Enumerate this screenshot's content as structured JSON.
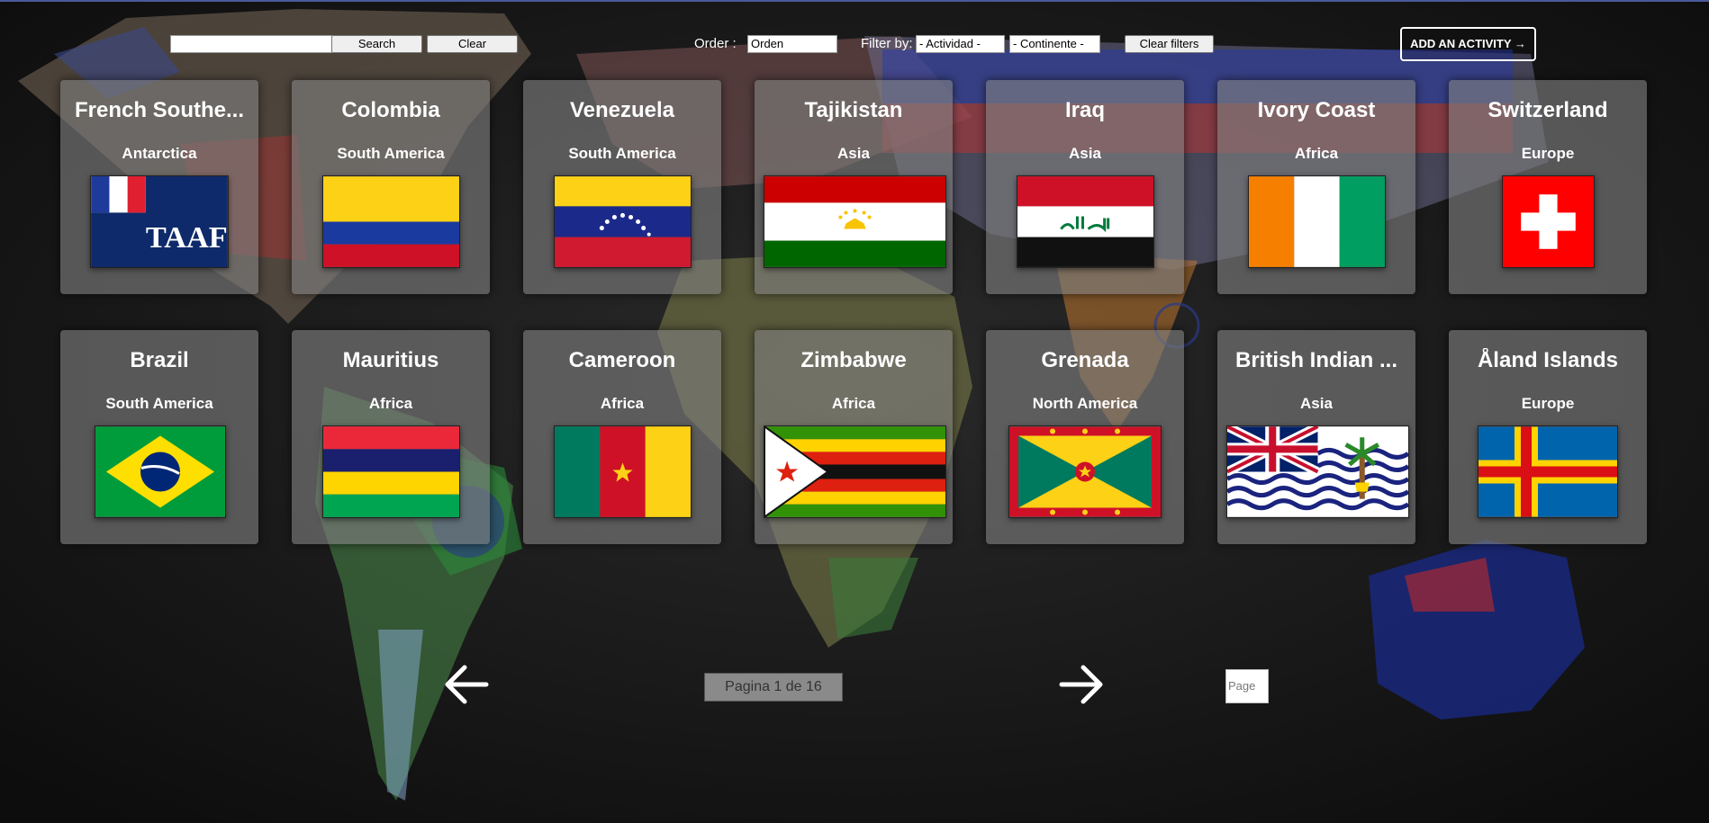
{
  "toolbar": {
    "search_placeholder": "",
    "search_label": "Search",
    "clear_label": "Clear",
    "order_label": "Order :",
    "order_value": "Orden",
    "filter_label": "Filter by:",
    "activity_value": "- Actividad -",
    "continent_value": "- Continente -",
    "clear_filters_label": "Clear filters",
    "add_activity_label": "ADD AN ACTIVITY →"
  },
  "countries": [
    {
      "name": "French Southe...",
      "continent": "Antarctica",
      "flag": "french-southern-territories"
    },
    {
      "name": "Colombia",
      "continent": "South America",
      "flag": "colombia"
    },
    {
      "name": "Venezuela",
      "continent": "South America",
      "flag": "venezuela"
    },
    {
      "name": "Tajikistan",
      "continent": "Asia",
      "flag": "tajikistan"
    },
    {
      "name": "Iraq",
      "continent": "Asia",
      "flag": "iraq"
    },
    {
      "name": "Ivory Coast",
      "continent": "Africa",
      "flag": "ivory-coast"
    },
    {
      "name": "Switzerland",
      "continent": "Europe",
      "flag": "switzerland"
    },
    {
      "name": "Brazil",
      "continent": "South America",
      "flag": "brazil"
    },
    {
      "name": "Mauritius",
      "continent": "Africa",
      "flag": "mauritius"
    },
    {
      "name": "Cameroon",
      "continent": "Africa",
      "flag": "cameroon"
    },
    {
      "name": "Zimbabwe",
      "continent": "Africa",
      "flag": "zimbabwe"
    },
    {
      "name": "Grenada",
      "continent": "North America",
      "flag": "grenada"
    },
    {
      "name": "British Indian ...",
      "continent": "Asia",
      "flag": "british-indian-ocean-territory"
    },
    {
      "name": "Åland Islands",
      "continent": "Europe",
      "flag": "aland-islands"
    }
  ],
  "pagination": {
    "indicator": "Pagina 1 de 16",
    "page_placeholder": "Page",
    "prev_icon": "arrow-left-icon",
    "next_icon": "arrow-right-icon"
  },
  "colors": {
    "card_bg": "#808080",
    "text": "#ffffff"
  }
}
